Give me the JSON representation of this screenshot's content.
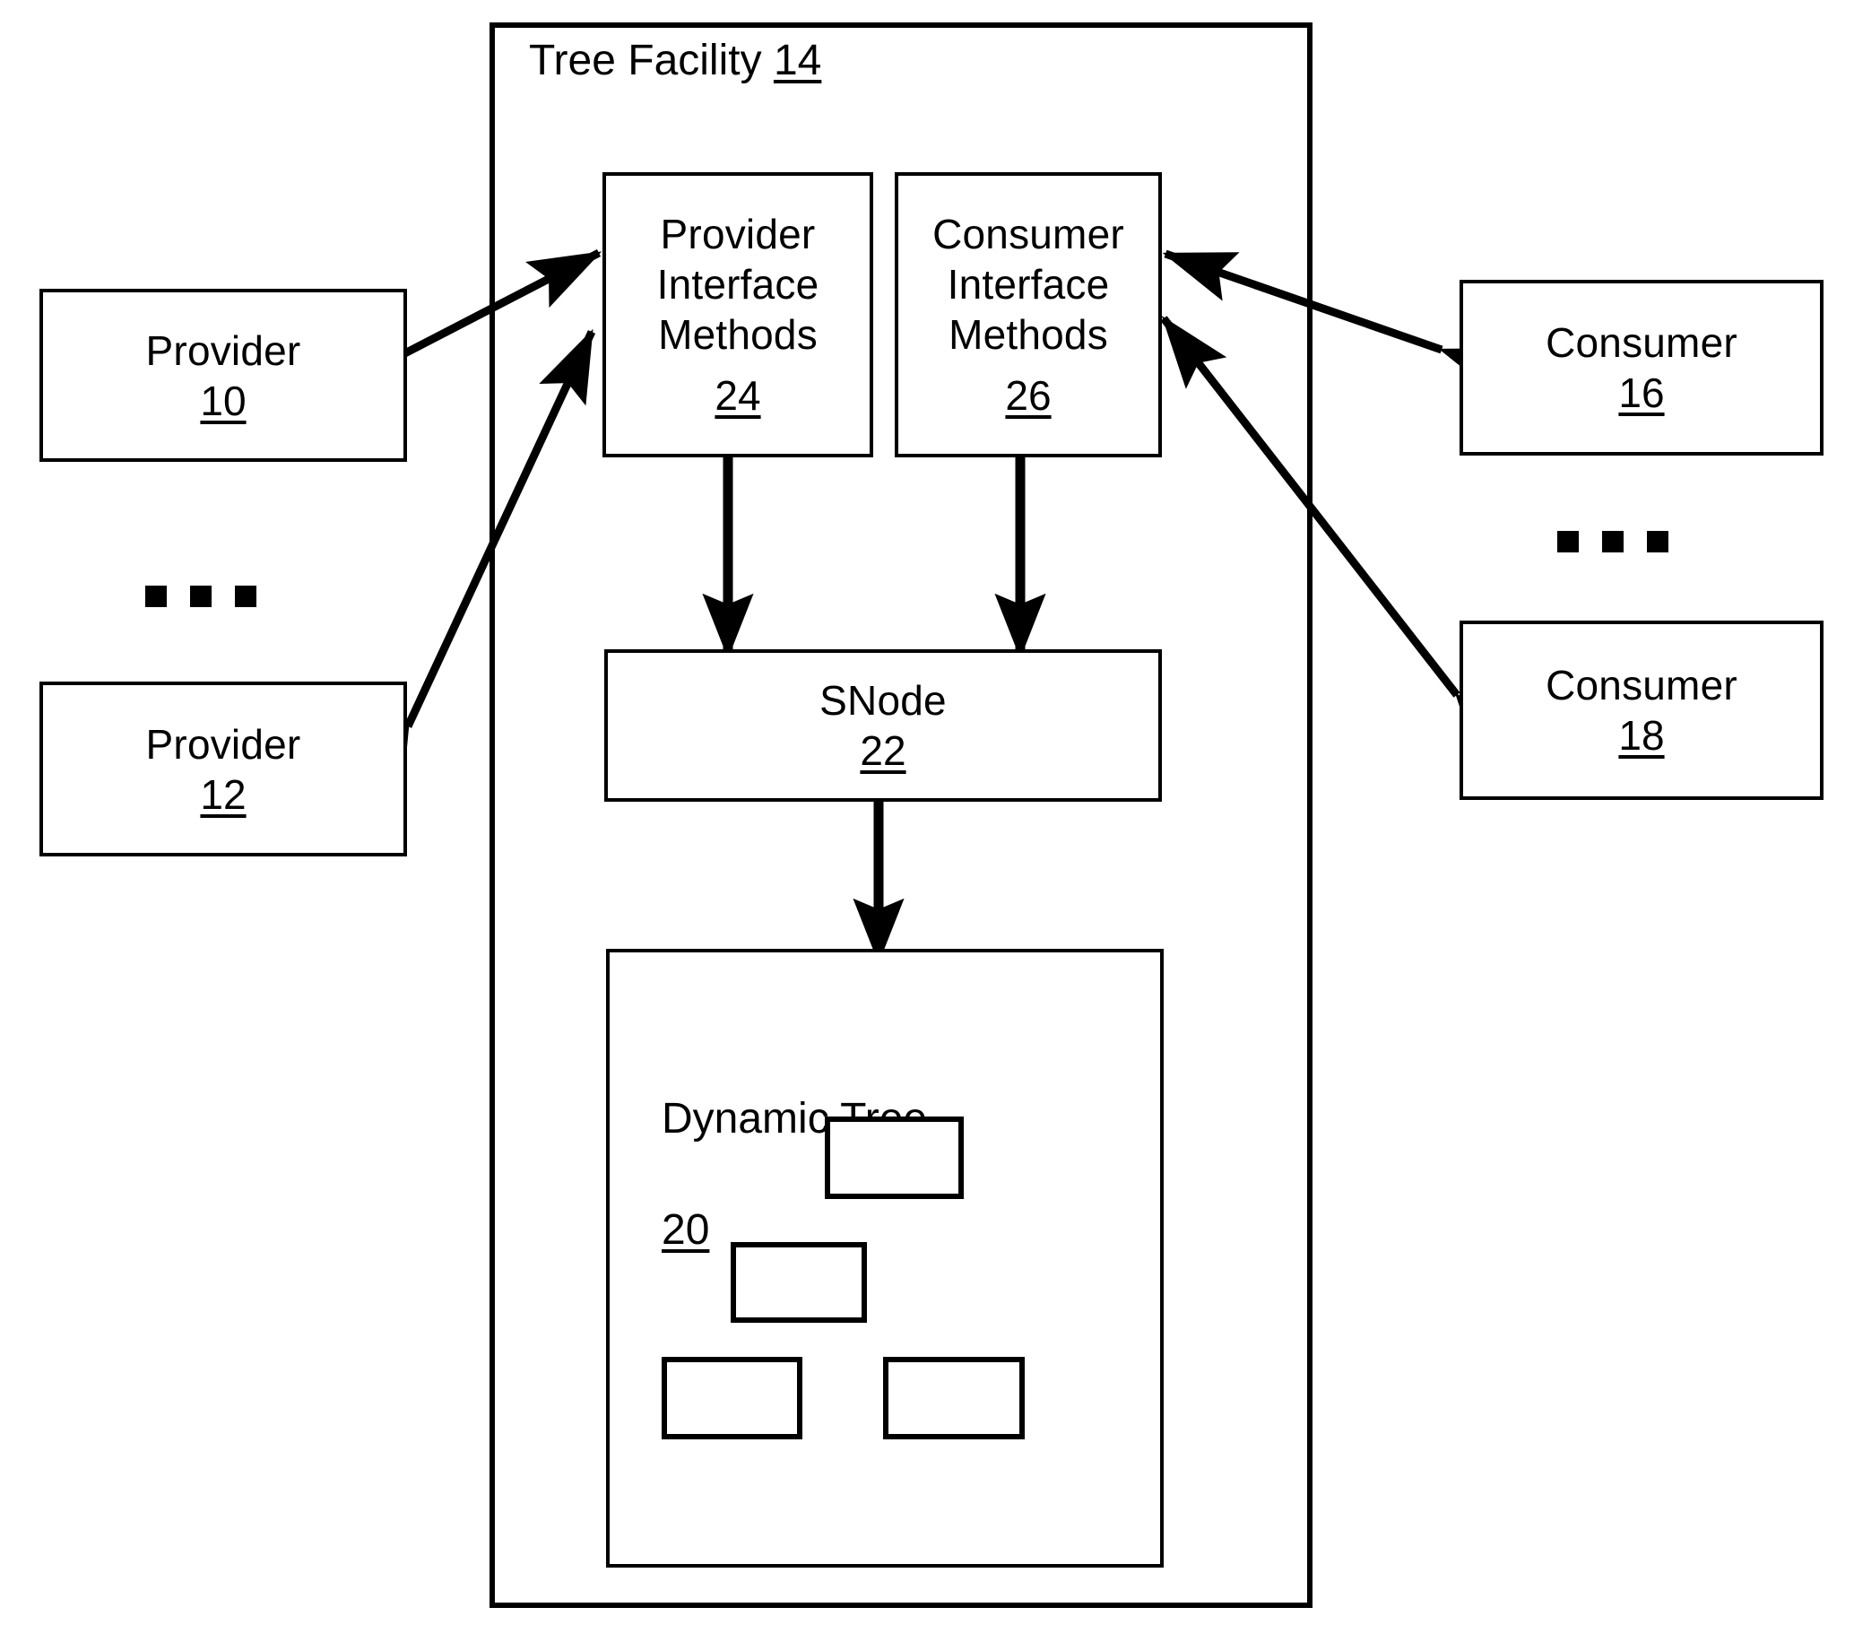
{
  "figure": {
    "type": "patent-block-diagram",
    "background_color": "#ffffff",
    "line_color": "#000000"
  },
  "tree_facility": {
    "title": "Tree Facility",
    "ref": "14"
  },
  "providers": [
    {
      "label": "Provider",
      "ref": "10"
    },
    {
      "label": "Provider",
      "ref": "12"
    }
  ],
  "consumers": [
    {
      "label": "Consumer",
      "ref": "16"
    },
    {
      "label": "Consumer",
      "ref": "18"
    }
  ],
  "interfaces": {
    "provider_interface": {
      "label": "Provider\nInterface\nMethods",
      "ref": "24"
    },
    "consumer_interface": {
      "label": "Consumer\nInterface\nMethods",
      "ref": "26"
    }
  },
  "snode": {
    "label": "SNode",
    "ref": "22"
  },
  "dynamic_tree": {
    "label": "Dynamic Tree",
    "ref": "20",
    "nodes": [
      "root",
      "child",
      "leaf-left",
      "leaf-right"
    ]
  },
  "ellipses": {
    "left": "▪ ▪ ▪",
    "right": "▪ ▪ ▪"
  },
  "connections": [
    {
      "from": "provider-10",
      "to": "provider-interface-methods-24",
      "style": "double-arrow"
    },
    {
      "from": "provider-12",
      "to": "provider-interface-methods-24",
      "style": "double-arrow"
    },
    {
      "from": "consumer-16",
      "to": "consumer-interface-methods-26",
      "style": "double-arrow"
    },
    {
      "from": "consumer-18",
      "to": "consumer-interface-methods-26",
      "style": "double-arrow"
    },
    {
      "from": "provider-interface-methods-24",
      "to": "snode-22",
      "style": "double-arrow-vertical"
    },
    {
      "from": "consumer-interface-methods-26",
      "to": "snode-22",
      "style": "double-arrow-vertical"
    },
    {
      "from": "snode-22",
      "to": "dynamic-tree-20",
      "style": "double-arrow-vertical"
    }
  ]
}
